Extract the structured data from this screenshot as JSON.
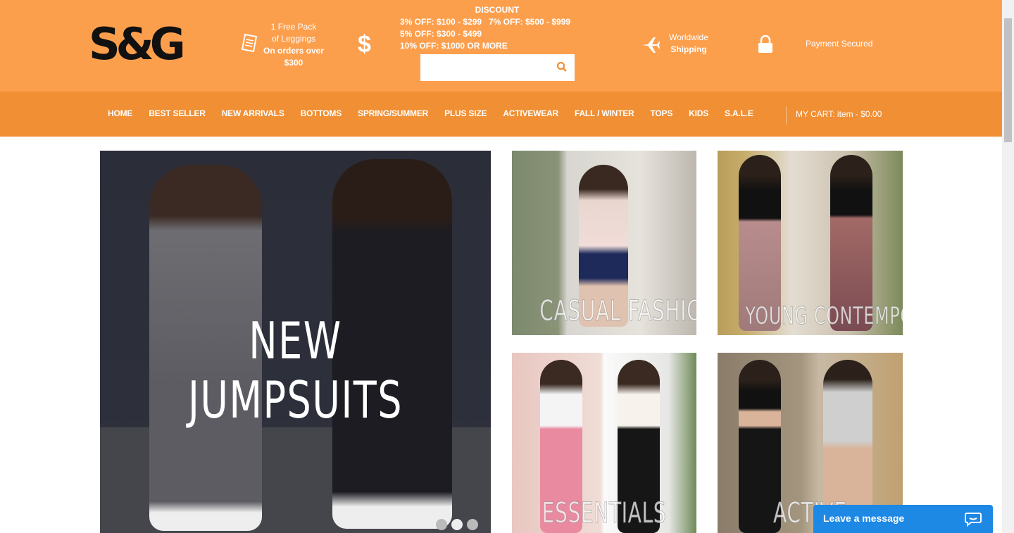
{
  "brand": {
    "logo_text": "S&G"
  },
  "header": {
    "promo": {
      "line1": "1 Free Pack",
      "line2": "of Leggings",
      "line3": "On orders over",
      "line4": "$300"
    },
    "dollar_icon": "$",
    "discount": {
      "title": "DISCOUNT",
      "row1a": "3% OFF: $100 - $299",
      "row1b": "7% OFF: $500 - $999",
      "row2a": "5% OFF: $300 - $499",
      "row2b": "10% OFF: $1000 OR MORE"
    },
    "search": {
      "value": ""
    },
    "shipping": {
      "line1": "Worldwide",
      "line2": "Shipping"
    },
    "secured": "Payment Secured"
  },
  "nav": {
    "items": [
      {
        "label": "HOME"
      },
      {
        "label": "BEST SELLER"
      },
      {
        "label": "NEW ARRIVALS"
      },
      {
        "label": "BOTTOMS"
      },
      {
        "label": "SPRING/SUMMER"
      },
      {
        "label": "PLUS SIZE"
      },
      {
        "label": "ACTIVEWEAR"
      },
      {
        "label": "FALL / WINTER"
      },
      {
        "label": "TOPS"
      },
      {
        "label": "KIDS"
      },
      {
        "label": "S.A.L.E"
      }
    ],
    "cart": "MY CART:  item - $0.00"
  },
  "hero": {
    "caption": "NEW JUMPSUITS",
    "slides": 3,
    "active_slide": 2
  },
  "tiles": [
    {
      "caption": "CASUAL FASHION"
    },
    {
      "caption": "YOUNG CONTEMPORARY"
    },
    {
      "caption": "ESSENTIALS"
    },
    {
      "caption": "ACTIVE"
    }
  ],
  "chat": {
    "label": "Leave a message"
  },
  "colors": {
    "header": "#fc9f4d",
    "nav": "#f08f34",
    "chat": "#1e88e5"
  }
}
